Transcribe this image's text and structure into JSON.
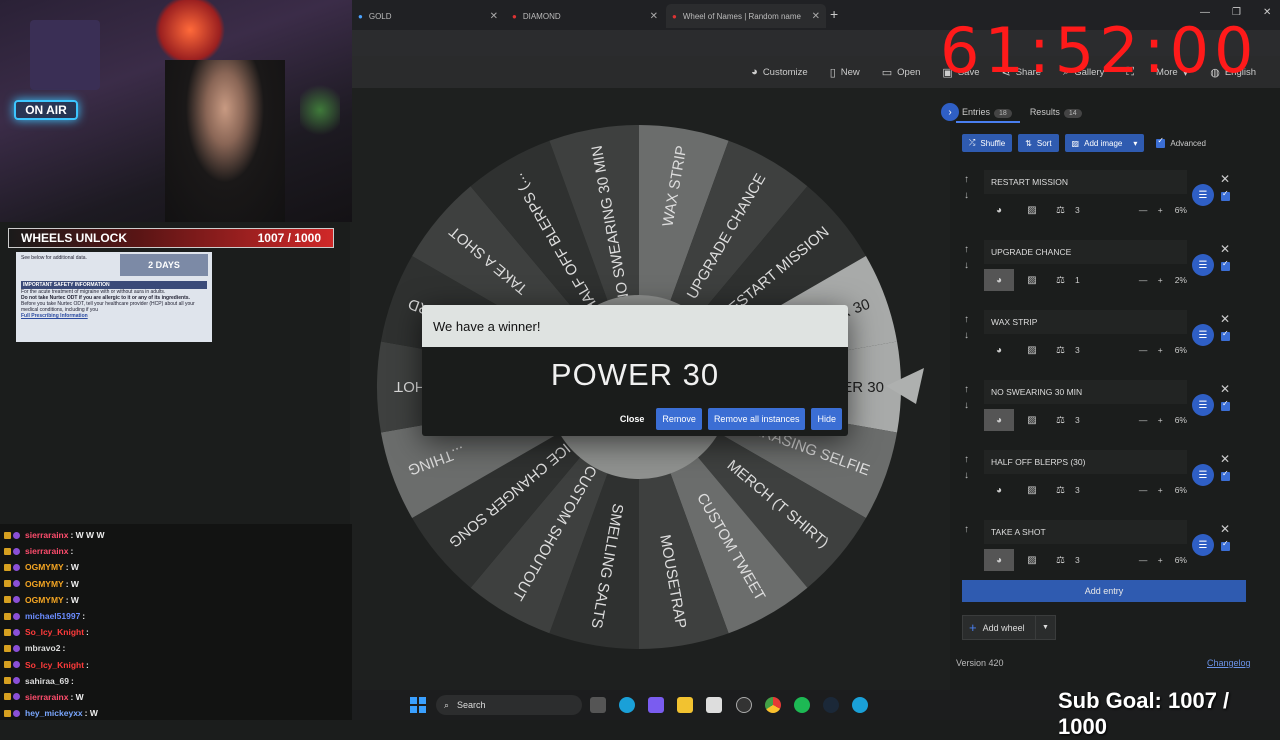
{
  "browser": {
    "tabs": [
      {
        "title": "GOLD",
        "icon": "tab-favicon"
      },
      {
        "title": "DIAMOND",
        "icon": "tab-favicon"
      },
      {
        "title": "Wheel of Names | Random name",
        "icon": "tab-favicon"
      }
    ]
  },
  "toolbar": {
    "customize": "Customize",
    "new": "New",
    "open": "Open",
    "save": "Save",
    "share": "Share",
    "gallery": "Gallery",
    "more": "More",
    "language": "English"
  },
  "wheel": {
    "segments": [
      "POWER 30",
      "EMBARRASING SELFIE",
      "MERCH (T SHIRT)",
      "CUSTOM TWEET",
      "MOUSETRAP",
      "SMELLING SALTS",
      "CUSTOM SHOUTOUT",
      "VOICE CHANGER SONG",
      "...THING",
      "...SHOT",
      "BAN A WORD",
      "TAKE A SHOT",
      "HALF OFF BLERPS (...",
      "NO SWEARING 30 MIN",
      "WAX STRIP",
      "UPGRADE CHANCE",
      "RESTART MISSION",
      "POWER 30"
    ],
    "colors": [
      "#a8aaa9",
      "#6b6d6c",
      "#3e403f",
      "#2f3130"
    ]
  },
  "dialog": {
    "title": "We have a winner!",
    "winner": "POWER 30",
    "close": "Close",
    "remove": "Remove",
    "remove_all": "Remove all instances",
    "hide": "Hide"
  },
  "panel": {
    "tab_entries": "Entries",
    "entries_count": "18",
    "tab_results": "Results",
    "results_count": "14",
    "shuffle": "Shuffle",
    "sort": "Sort",
    "add_image": "Add image",
    "advanced": "Advanced",
    "entries": [
      {
        "name": "RESTART MISSION",
        "weight": "3",
        "pct": "6%"
      },
      {
        "name": "UPGRADE CHANCE",
        "weight": "1",
        "pct": "2%"
      },
      {
        "name": "WAX STRIP",
        "weight": "3",
        "pct": "6%"
      },
      {
        "name": "NO SWEARING 30 MIN",
        "weight": "3",
        "pct": "6%"
      },
      {
        "name": "HALF OFF BLERPS (30)",
        "weight": "3",
        "pct": "6%"
      },
      {
        "name": "TAKE A SHOT",
        "weight": "3",
        "pct": "6%"
      }
    ],
    "add_entry": "Add entry",
    "add_wheel": "Add wheel",
    "version": "Version 420",
    "changelog": "Changelog"
  },
  "overlay": {
    "on_air": "ON AIR",
    "wheels_label": "WHEELS UNLOCK",
    "wheels_value": "1007 / 1000",
    "timer": "61:52:00",
    "sub_goal": "Sub Goal: 1007 / 1000",
    "ad": {
      "tag": "2 DAYS",
      "line1": "See below for additional data.",
      "line2": "For the acute treatment of migraine with or without aura in adults.",
      "heading": "IMPORTANT SAFETY INFORMATION",
      "line3": "Do not take Nurtec ODT if you are allergic to it or any of its ingredients.",
      "line4": "Before you take Nurtec ODT, tell your healthcare provider (HCP) about all your medical conditions, including if you",
      "link": "Full Prescribing Information"
    }
  },
  "chat": [
    {
      "user": "sierrarainx",
      "color": "#ff4d6d",
      "text": ": W W W"
    },
    {
      "user": "sierrarainx",
      "color": "#ff4d6d",
      "text": ":"
    },
    {
      "user": "OGMYMY",
      "color": "#f5a623",
      "text": ": W"
    },
    {
      "user": "OGMYMY",
      "color": "#f5a623",
      "text": ": W"
    },
    {
      "user": "OGMYMY",
      "color": "#f5a623",
      "text": ": W"
    },
    {
      "user": "michael51997",
      "color": "#6b8cff",
      "text": ":"
    },
    {
      "user": "So_Icy_Knight",
      "color": "#ff3b3b",
      "text": ":"
    },
    {
      "user": "mbravo2",
      "color": "#dddddd",
      "text": ":"
    },
    {
      "user": "So_Icy_Knight",
      "color": "#ff3b3b",
      "text": ":"
    },
    {
      "user": "sahiraa_69",
      "color": "#dddddd",
      "text": ":"
    },
    {
      "user": "sierrarainx",
      "color": "#ff4d6d",
      "text": ": W"
    },
    {
      "user": "hey_mickeyxx",
      "color": "#7aa7ff",
      "text": ": W"
    }
  ],
  "taskbar": {
    "search": "Search"
  }
}
